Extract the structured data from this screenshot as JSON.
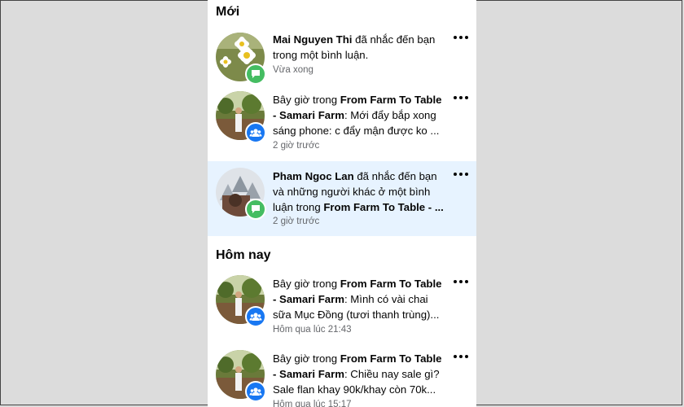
{
  "sections": {
    "new_title": "Mới",
    "today_title": "Hôm nay"
  },
  "notifications": [
    {
      "actor": "Mai Nguyen Thi",
      "line1_rest": " đã nhắc đến bạn",
      "line2": "trong một bình luận.",
      "time": "Vừa xong",
      "badge": "comment-icon"
    },
    {
      "pre": "Bây giờ trong ",
      "group_a": "From Farm To Table",
      "group_b": "- Samari Farm",
      "rest1": ": Mới đẩy bắp xong",
      "line3": "sáng phone: c đẩy mận được ko ...",
      "time": "2 giờ trước",
      "badge": "group-icon"
    },
    {
      "actor": "Pham Ngoc Lan",
      "line1_rest": " đã nhắc đến bạn",
      "line2": "và những người khác ở một bình",
      "line3_pre": "luận trong ",
      "line3_bold": "From Farm To Table - ...",
      "time": "2 giờ trước",
      "badge": "comment-icon"
    },
    {
      "pre": "Bây giờ trong ",
      "group_a": "From Farm To Table",
      "group_b": "- Samari Farm",
      "rest1": ": Mình có vài chai",
      "line3": "sữa Mục Đồng (tươi thanh trùng)...",
      "time": "Hôm qua lúc 21:43",
      "badge": "group-icon"
    },
    {
      "pre": "Bây giờ trong ",
      "group_a": "From Farm To Table",
      "group_b": "- Samari Farm",
      "rest1": ": Chiều nay sale gì?",
      "line3": "Sale flan khay 90k/khay còn 70k...",
      "time": "Hôm qua lúc 15:17",
      "badge": "group-icon"
    }
  ],
  "colors": {
    "unread_bg": "#e7f3ff",
    "comment_badge": "#45bd62",
    "group_badge": "#1877f2",
    "time_text": "#65676b"
  }
}
